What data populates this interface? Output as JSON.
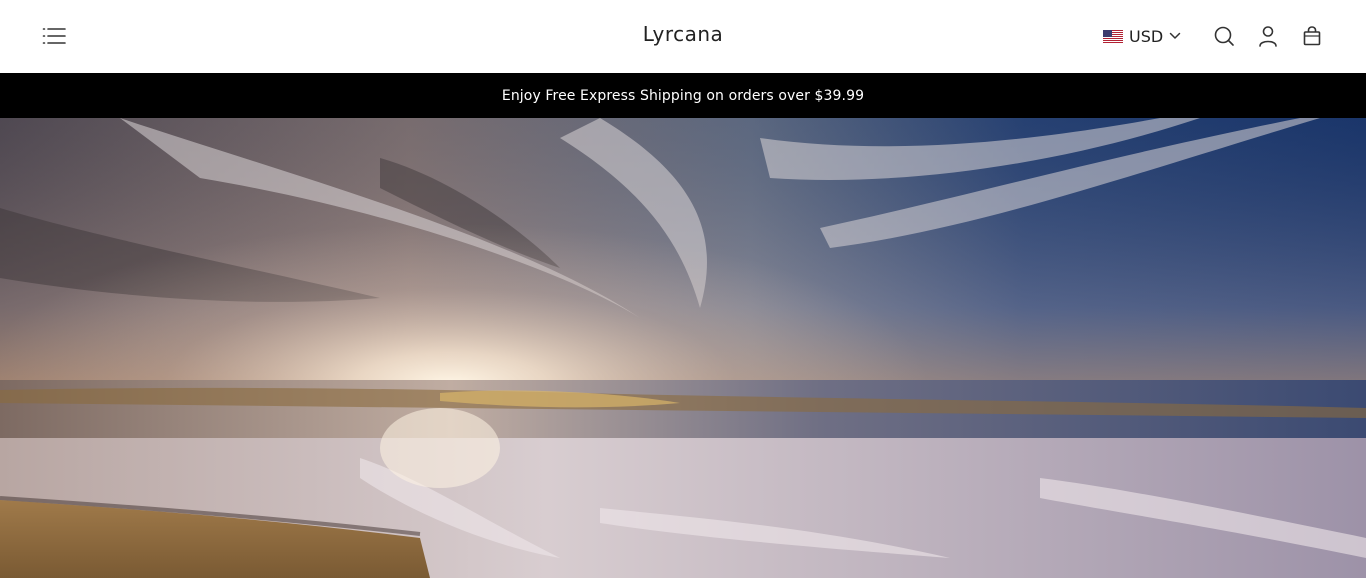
{
  "header": {
    "brand": "Lyrcana",
    "currency": {
      "code": "USD",
      "flag_icon": "us-flag-icon"
    },
    "icons": [
      "menu-icon",
      "search-icon",
      "account-icon",
      "cart-icon"
    ]
  },
  "announcement": {
    "text": "Enjoy Free Express Shipping on orders over $39.99"
  },
  "colors": {
    "announcement_bg": "#000000",
    "announcement_text": "#ffffff",
    "header_bg": "#ffffff"
  }
}
